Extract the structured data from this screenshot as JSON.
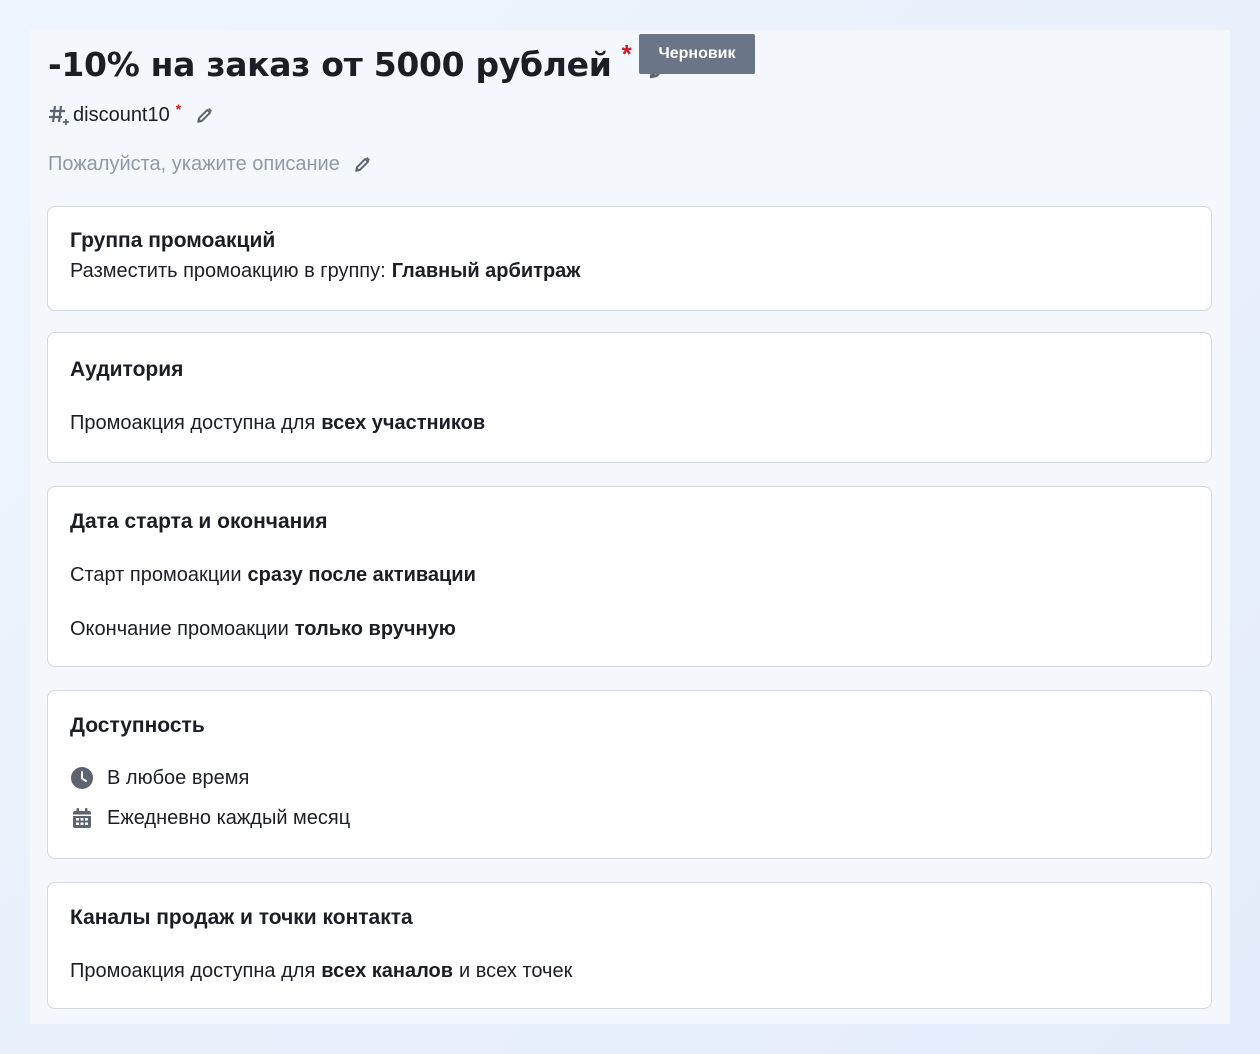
{
  "promo": {
    "title": "-10% на заказ от 5000 рублей",
    "required_mark": "*",
    "status_badge": "Черновик",
    "code": "discount10",
    "description_placeholder": "Пожалуйста, укажите описание"
  },
  "sections": {
    "group": {
      "title": "Группа промоакций",
      "label": "Разместить промоакцию в группу:",
      "value": "Главный арбитраж"
    },
    "audience": {
      "title": "Аудитория",
      "label": "Промоакция доступна для",
      "value": "всех участников"
    },
    "dates": {
      "title": "Дата старта и окончания",
      "start_label": "Старт промоакции",
      "start_value": "сразу после активации",
      "end_label": "Окончание промоакции",
      "end_value": "только вручную"
    },
    "availability": {
      "title": "Доступность",
      "time_text": "В любое время",
      "schedule_text": "Ежедневно каждый месяц"
    },
    "channels": {
      "title": "Каналы продаж и точки контакта",
      "label": "Промоакция доступна для",
      "value": "всех каналов",
      "suffix": "и всех точек"
    }
  },
  "icons": {
    "edit": "pencil-icon",
    "code": "hash-plus-icon",
    "time": "clock-icon",
    "schedule": "calendar-icon"
  },
  "colors": {
    "required": "#d11a2a",
    "badge_bg": "#6b7588",
    "placeholder": "#9099a6"
  }
}
